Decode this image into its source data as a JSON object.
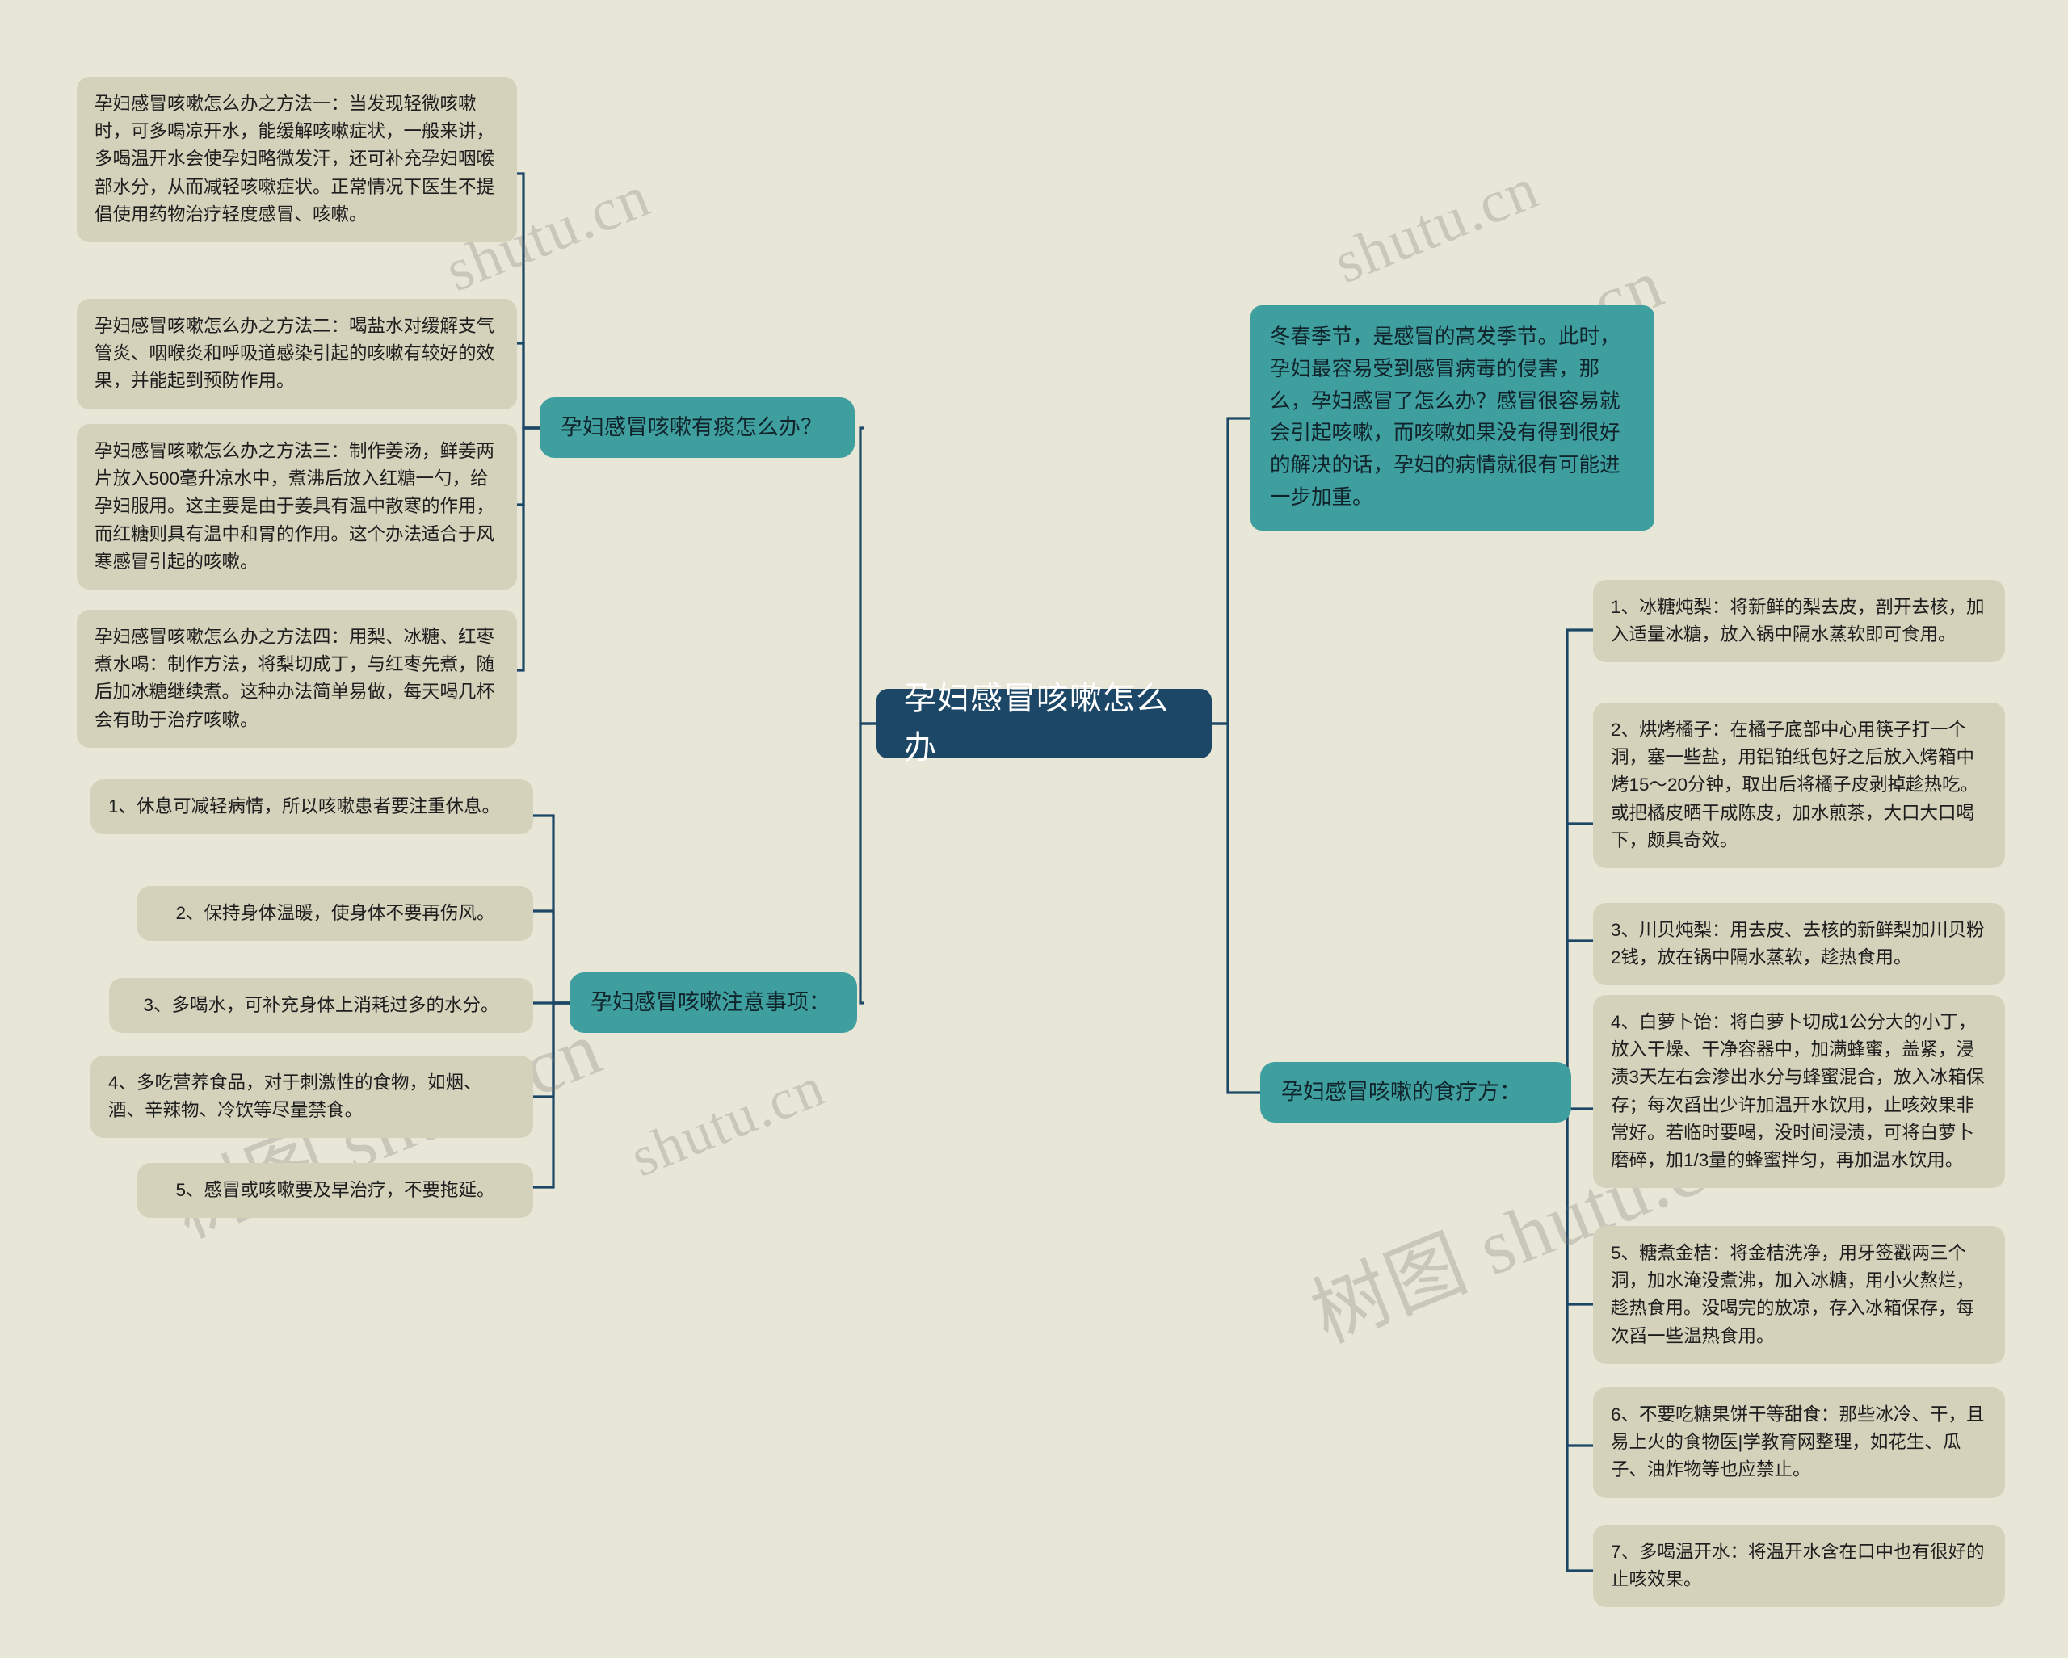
{
  "theme": {
    "background": "#e8e6d6",
    "leaf_fill": "#d4d2bb",
    "branch_fill": "#3f9e9e",
    "root_fill": "#1c4767",
    "root_text": "#ffffff",
    "link_color": "#1c4767"
  },
  "watermark": {
    "text_cn": "树图 shutu.cn",
    "text_domain": "shutu.cn"
  },
  "root": {
    "label": "孕妇感冒咳嗽怎么办"
  },
  "intro": {
    "text": "冬春季节，是感冒的高发季节。此时，孕妇最容易受到感冒病毒的侵害，那么，孕妇感冒了怎么办？感冒很容易就会引起咳嗽，而咳嗽如果没有得到很好的解决的话，孕妇的病情就很有可能进一步加重。"
  },
  "branches": [
    {
      "id": "phlegm",
      "label": "孕妇感冒咳嗽有痰怎么办？",
      "children": [
        {
          "id": "method-1",
          "text": "孕妇感冒咳嗽怎么办之方法一：当发现轻微咳嗽时，可多喝凉开水，能缓解咳嗽症状，一般来讲，多喝温开水会使孕妇略微发汗，还可补充孕妇咽喉部水分，从而减轻咳嗽症状。正常情况下医生不提倡使用药物治疗轻度感冒、咳嗽。"
        },
        {
          "id": "method-2",
          "text": "孕妇感冒咳嗽怎么办之方法二：喝盐水对缓解支气管炎、咽喉炎和呼吸道感染引起的咳嗽有较好的效果，并能起到预防作用。"
        },
        {
          "id": "method-3",
          "text": "孕妇感冒咳嗽怎么办之方法三：制作姜汤，鲜姜两片放入500毫升凉水中，煮沸后放入红糖一勺，给孕妇服用。这主要是由于姜具有温中散寒的作用，而红糖则具有温中和胃的作用。这个办法适合于风寒感冒引起的咳嗽。"
        },
        {
          "id": "method-4",
          "text": "孕妇感冒咳嗽怎么办之方法四：用梨、冰糖、红枣煮水喝：制作方法，将梨切成丁，与红枣先煮，随后加冰糖继续煮。这种办法简单易做，每天喝几杯会有助于治疗咳嗽。"
        }
      ]
    },
    {
      "id": "notes",
      "label": "孕妇感冒咳嗽注意事项：",
      "children": [
        {
          "id": "note-1",
          "text": "1、休息可减轻病情，所以咳嗽患者要注重休息。"
        },
        {
          "id": "note-2",
          "text": "2、保持身体温暖，使身体不要再伤风。"
        },
        {
          "id": "note-3",
          "text": "3、多喝水，可补充身体上消耗过多的水分。"
        },
        {
          "id": "note-4",
          "text": "4、多吃营养食品，对于刺激性的食物，如烟、酒、辛辣物、冷饮等尽量禁食。"
        },
        {
          "id": "note-5",
          "text": "5、感冒或咳嗽要及早治疗，不要拖延。"
        }
      ]
    },
    {
      "id": "diet",
      "label": "孕妇感冒咳嗽的食疗方：",
      "children": [
        {
          "id": "diet-1",
          "text": "1、冰糖炖梨：将新鲜的梨去皮，剖开去核，加入适量冰糖，放入锅中隔水蒸软即可食用。"
        },
        {
          "id": "diet-2",
          "text": "2、烘烤橘子：在橘子底部中心用筷子打一个洞，塞一些盐，用铝铂纸包好之后放入烤箱中烤15～20分钟，取出后将橘子皮剥掉趁热吃。或把橘皮晒干成陈皮，加水煎茶，大口大口喝下，颇具奇效。"
        },
        {
          "id": "diet-3",
          "text": "3、川贝炖梨：用去皮、去核的新鲜梨加川贝粉2钱，放在锅中隔水蒸软，趁热食用。"
        },
        {
          "id": "diet-4",
          "text": "4、白萝卜饴：将白萝卜切成1公分大的小丁，放入干燥、干净容器中，加满蜂蜜，盖紧，浸渍3天左右会渗出水分与蜂蜜混合，放入冰箱保存；每次舀出少许加温开水饮用，止咳效果非常好。若临时要喝，没时间浸渍，可将白萝卜磨碎，加1/3量的蜂蜜拌匀，再加温水饮用。"
        },
        {
          "id": "diet-5",
          "text": "5、糖煮金桔：将金桔洗净，用牙签戳两三个洞，加水淹没煮沸，加入冰糖，用小火熬烂，趁热食用。没喝完的放凉，存入冰箱保存，每次舀一些温热食用。"
        },
        {
          "id": "diet-6",
          "text": "6、不要吃糖果饼干等甜食：那些冰冷、干，且易上火的食物医|学教育网整理，如花生、瓜子、油炸物等也应禁止。"
        },
        {
          "id": "diet-7",
          "text": "7、多喝温开水：将温开水含在口中也有很好的止咳效果。"
        }
      ]
    }
  ]
}
